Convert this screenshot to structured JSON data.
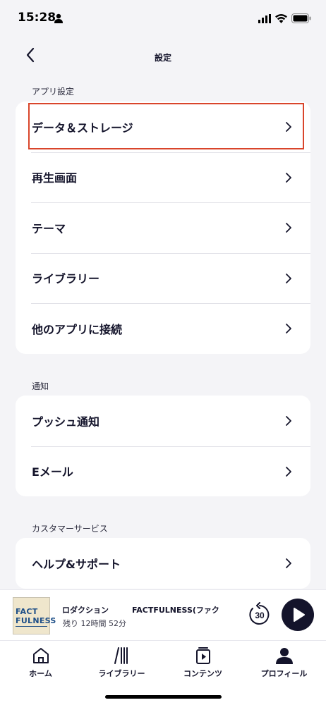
{
  "status_bar": {
    "time": "15:28"
  },
  "header": {
    "title": "設定"
  },
  "sections": [
    {
      "label": "アプリ設定",
      "items": [
        {
          "label": "データ＆ストレージ"
        },
        {
          "label": "再生画面"
        },
        {
          "label": "テーマ"
        },
        {
          "label": "ライブラリー"
        },
        {
          "label": "他のアプリに接続"
        }
      ]
    },
    {
      "label": "通知",
      "items": [
        {
          "label": "プッシュ通知"
        },
        {
          "label": "Eメール"
        }
      ]
    },
    {
      "label": "カスタマーサービス",
      "items": [
        {
          "label": "ヘルプ&サポート"
        }
      ]
    }
  ],
  "player": {
    "cover_text": "FACT FULNESS",
    "title": "ロダクション　　　FACTFULNESS(ファク",
    "remaining": "残り 12時間 52分",
    "rewind_seconds": "30"
  },
  "tabs": [
    {
      "label": "ホーム",
      "icon": "home-icon"
    },
    {
      "label": "ライブラリー",
      "icon": "library-icon"
    },
    {
      "label": "コンテンツ",
      "icon": "contents-icon"
    },
    {
      "label": "プロフィール",
      "icon": "profile-icon"
    }
  ],
  "colors": {
    "background": "#f4f4f7",
    "text": "#14142b",
    "highlight": "#d9452b",
    "cover_ink": "#1d4e87"
  }
}
